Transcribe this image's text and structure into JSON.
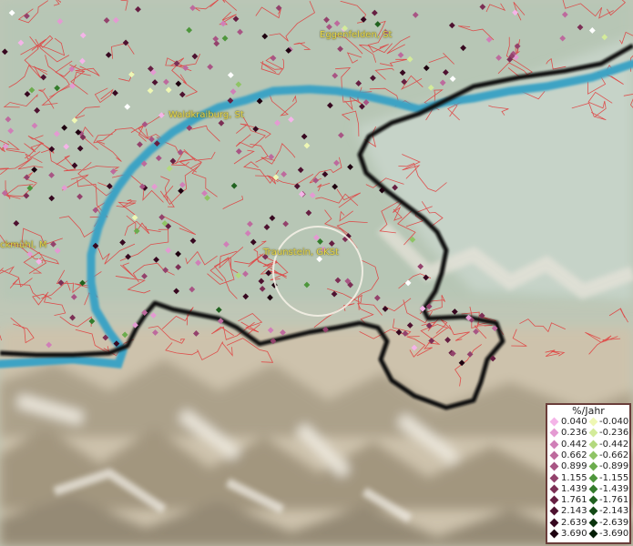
{
  "places": [
    {
      "name": "Eggenfelden, St"
    },
    {
      "name": "Waldkraiburg, St"
    },
    {
      "name": "Traunstein, GKSt"
    },
    {
      "name": "ckmühl, M"
    }
  ],
  "legend": {
    "title": "%/Jahr",
    "positive": [
      {
        "label": "0.040",
        "color": "#f4b4e8"
      },
      {
        "label": "0.236",
        "color": "#e49ad2"
      },
      {
        "label": "0.442",
        "color": "#d07fb8"
      },
      {
        "label": "0.662",
        "color": "#bd6a9d"
      },
      {
        "label": "0.899",
        "color": "#a85584"
      },
      {
        "label": "1.155",
        "color": "#93426c"
      },
      {
        "label": "1.439",
        "color": "#7c2f55"
      },
      {
        "label": "1.761",
        "color": "#661f42"
      },
      {
        "label": "2.143",
        "color": "#4e1230"
      },
      {
        "label": "2.639",
        "color": "#370820"
      },
      {
        "label": "3.690",
        "color": "#1e0210"
      }
    ],
    "negative": [
      {
        "label": "-0.040",
        "color": "#eef7b4"
      },
      {
        "label": "-0.236",
        "color": "#d3eb9a"
      },
      {
        "label": "-0.442",
        "color": "#b3d97e"
      },
      {
        "label": "-0.662",
        "color": "#8fc465"
      },
      {
        "label": "-0.899",
        "color": "#6cac4d"
      },
      {
        "label": "-1.155",
        "color": "#4e963c"
      },
      {
        "label": "-1.439",
        "color": "#347c2c"
      },
      {
        "label": "-1.761",
        "color": "#216220"
      },
      {
        "label": "-2.143",
        "color": "#144a16"
      },
      {
        "label": "-2.639",
        "color": "#0a340d"
      },
      {
        "label": "-3.690",
        "color": "#031e06"
      }
    ]
  },
  "colors": {
    "river": "#3ea3c4",
    "border": "#111111",
    "municipal_lines": "#e23a3a",
    "label_text": "#e8d84a"
  }
}
